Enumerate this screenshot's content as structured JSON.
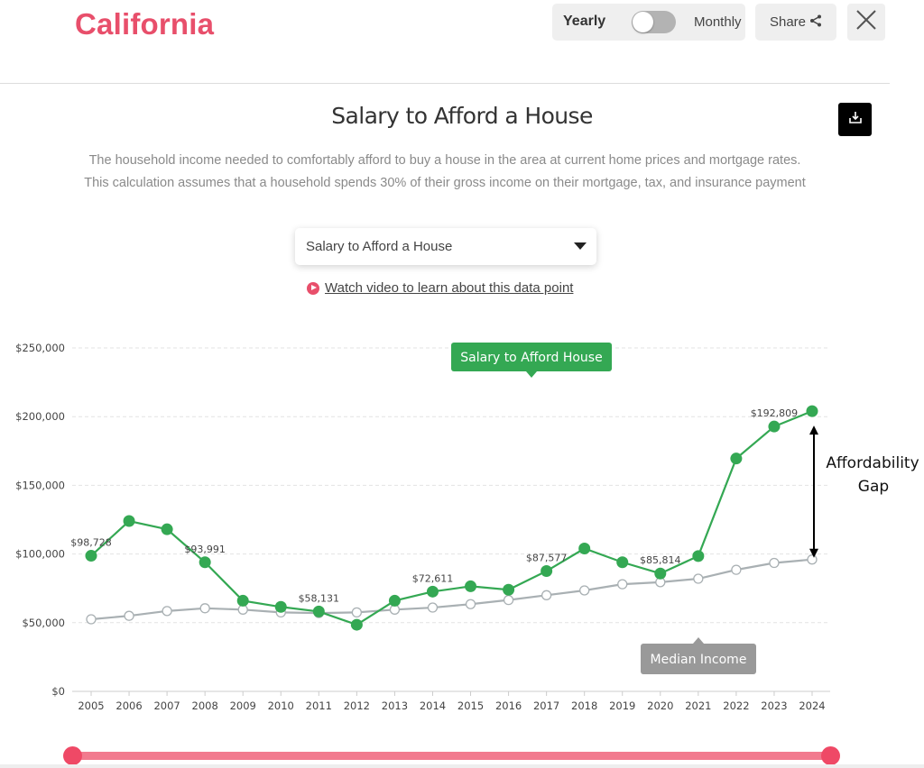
{
  "header": {
    "state_title": "California",
    "toggle": {
      "left_label": "Yearly",
      "right_label": "Monthly",
      "selected": "Yearly"
    },
    "share_label": "Share",
    "share_icon": "share-icon",
    "close_icon": "close-icon"
  },
  "section": {
    "title": "Salary to Afford a House",
    "download_icon": "download-icon",
    "description": "The household income needed to comfortably afford to buy a house in the area at current home prices and mortgage rates. This calculation assumes that a household spends 30% of their gross income on their mortgage, tax, and insurance payment",
    "dropdown_selected": "Salary to Afford a House",
    "video_link": "Watch video to learn about this data point"
  },
  "colors": {
    "brand": "#e84f6b",
    "salary_series": "#34a853",
    "income_series": "#a9b0b3",
    "slider": "#f27a8e"
  },
  "chart_data": {
    "type": "line",
    "title": "Salary to Afford a House",
    "xlabel": "",
    "ylabel": "",
    "ylim": [
      0,
      250000
    ],
    "yticks": [
      0,
      50000,
      100000,
      150000,
      200000,
      250000
    ],
    "ytick_labels": [
      "$0",
      "$50,000",
      "$100,000",
      "$150,000",
      "$200,000",
      "$250,000"
    ],
    "grid": true,
    "x": [
      "2005",
      "2006",
      "2007",
      "2008",
      "2009",
      "2010",
      "2011",
      "2012",
      "2013",
      "2014",
      "2015",
      "2016",
      "2017",
      "2018",
      "2019",
      "2020",
      "2021",
      "2022",
      "2023",
      "2024"
    ],
    "series": [
      {
        "name": "Salary to Afford House",
        "color": "#34a853",
        "marker": "filled",
        "values": [
          98728,
          124000,
          118000,
          93991,
          66000,
          61500,
          58131,
          48500,
          66000,
          72611,
          76500,
          74000,
          87577,
          104000,
          94000,
          85814,
          98500,
          169500,
          192809,
          204000
        ]
      },
      {
        "name": "Median Income",
        "color": "#a9b0b3",
        "marker": "hollow",
        "values": [
          52500,
          55000,
          58500,
          60500,
          59500,
          57500,
          57000,
          57500,
          59500,
          61000,
          63500,
          66500,
          70000,
          73500,
          78000,
          79500,
          82000,
          88500,
          93500,
          96000
        ]
      }
    ],
    "data_labels": [
      {
        "series": 0,
        "index": 0,
        "text": "$98,728"
      },
      {
        "series": 0,
        "index": 3,
        "text": "$93,991"
      },
      {
        "series": 0,
        "index": 6,
        "text": "$58,131"
      },
      {
        "series": 0,
        "index": 9,
        "text": "$72,611"
      },
      {
        "series": 0,
        "index": 12,
        "text": "$87,577"
      },
      {
        "series": 0,
        "index": 15,
        "text": "$85,814"
      },
      {
        "series": 0,
        "index": 18,
        "text": "$192,809"
      }
    ],
    "legend_tags": [
      {
        "series": 0,
        "text": "Salary to Afford House",
        "placement": "top-center"
      },
      {
        "series": 1,
        "text": "Median Income",
        "placement": "bottom-right"
      }
    ],
    "annotation": {
      "text_line1": "Affordability",
      "text_line2": "Gap",
      "between_index": 19
    }
  },
  "range_slider": {
    "start": "2005",
    "end": "2024"
  }
}
